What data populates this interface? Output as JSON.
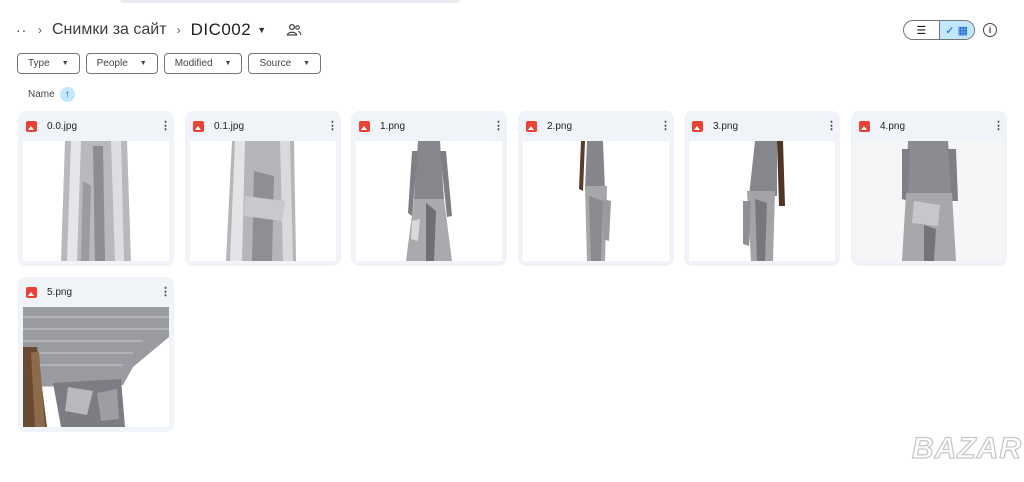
{
  "breadcrumb": {
    "overflow_label": "··",
    "parent": "Снимки за сайт",
    "current": "DIC002"
  },
  "view": {
    "list_label": "☰",
    "grid_label": "✓ ▦"
  },
  "filters": [
    {
      "label": "Type"
    },
    {
      "label": "People"
    },
    {
      "label": "Modified"
    },
    {
      "label": "Source"
    }
  ],
  "sort": {
    "label": "Name",
    "direction": "ascending"
  },
  "files": [
    {
      "name": "0.0.jpg",
      "thumb": "skirt-front"
    },
    {
      "name": "0.1.jpg",
      "thumb": "skirt-back"
    },
    {
      "name": "1.png",
      "thumb": "model-front"
    },
    {
      "name": "2.png",
      "thumb": "model-side"
    },
    {
      "name": "3.png",
      "thumb": "model-side-right"
    },
    {
      "name": "4.png",
      "thumb": "model-front-close"
    },
    {
      "name": "5.png",
      "thumb": "detail-closeup"
    }
  ],
  "watermark": "BAZAR",
  "colors": {
    "card_bg": "#f0f4f9",
    "accent": "#c2e7ff",
    "file_icon": "#ea4335",
    "silver": "#b8b8bc",
    "knit": "#8a8b90"
  }
}
